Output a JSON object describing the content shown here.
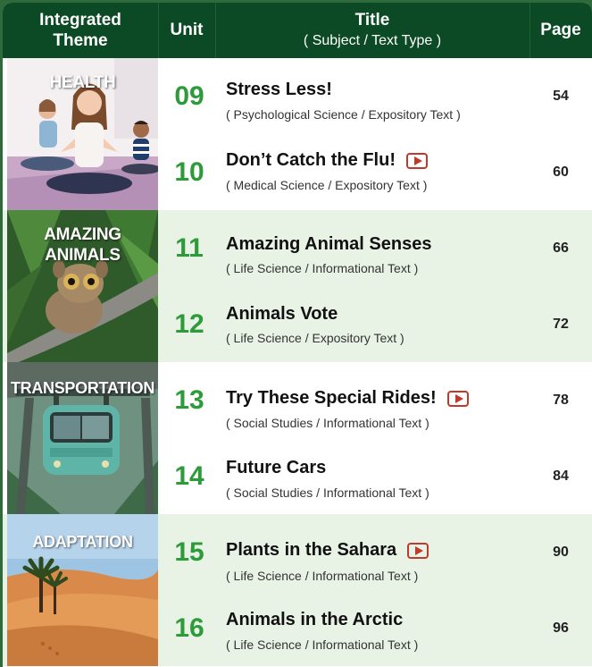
{
  "header": {
    "theme_line1": "Integrated",
    "theme_line2": "Theme",
    "unit": "Unit",
    "title": "Title",
    "title_sub": "( Subject / Text Type )",
    "page": "Page"
  },
  "colors": {
    "header_bg": "#0b4a24",
    "unit_green": "#2e9b3a",
    "row_green": "#e8f3e6",
    "video_red": "#c0392b"
  },
  "themes": [
    {
      "label_line1": "HEALTH",
      "label_line2": ""
    },
    {
      "label_line1": "AMAZING",
      "label_line2": "ANIMALS"
    },
    {
      "label_line1": "TRANSPORTATION",
      "label_line2": ""
    },
    {
      "label_line1": "ADAPTATION",
      "label_line2": ""
    }
  ],
  "units": [
    {
      "unit": "09",
      "title": "Stress Less!",
      "subtitle": "( Psychological Science / Expository Text )",
      "page": "54",
      "video": false
    },
    {
      "unit": "10",
      "title": "Don’t Catch the Flu!",
      "subtitle": "( Medical Science / Expository Text )",
      "page": "60",
      "video": true,
      "video_icon": "play-video-icon"
    },
    {
      "unit": "11",
      "title": "Amazing Animal Senses",
      "subtitle": "( Life Science / Informational Text )",
      "page": "66",
      "video": false
    },
    {
      "unit": "12",
      "title": "Animals Vote",
      "subtitle": "( Life Science / Expository Text )",
      "page": "72",
      "video": false
    },
    {
      "unit": "13",
      "title": "Try These Special Rides!",
      "subtitle": "( Social Studies / Informational Text )",
      "page": "78",
      "video": true,
      "video_icon": "play-video-icon"
    },
    {
      "unit": "14",
      "title": "Future Cars",
      "subtitle": "( Social Studies / Informational Text )",
      "page": "84",
      "video": false
    },
    {
      "unit": "15",
      "title": "Plants in the Sahara",
      "subtitle": "( Life Science / Informational Text )",
      "page": "90",
      "video": true,
      "video_icon": "play-video-icon"
    },
    {
      "unit": "16",
      "title": "Animals in the Arctic",
      "subtitle": "( Life Science / Informational Text )",
      "page": "96",
      "video": false
    }
  ]
}
